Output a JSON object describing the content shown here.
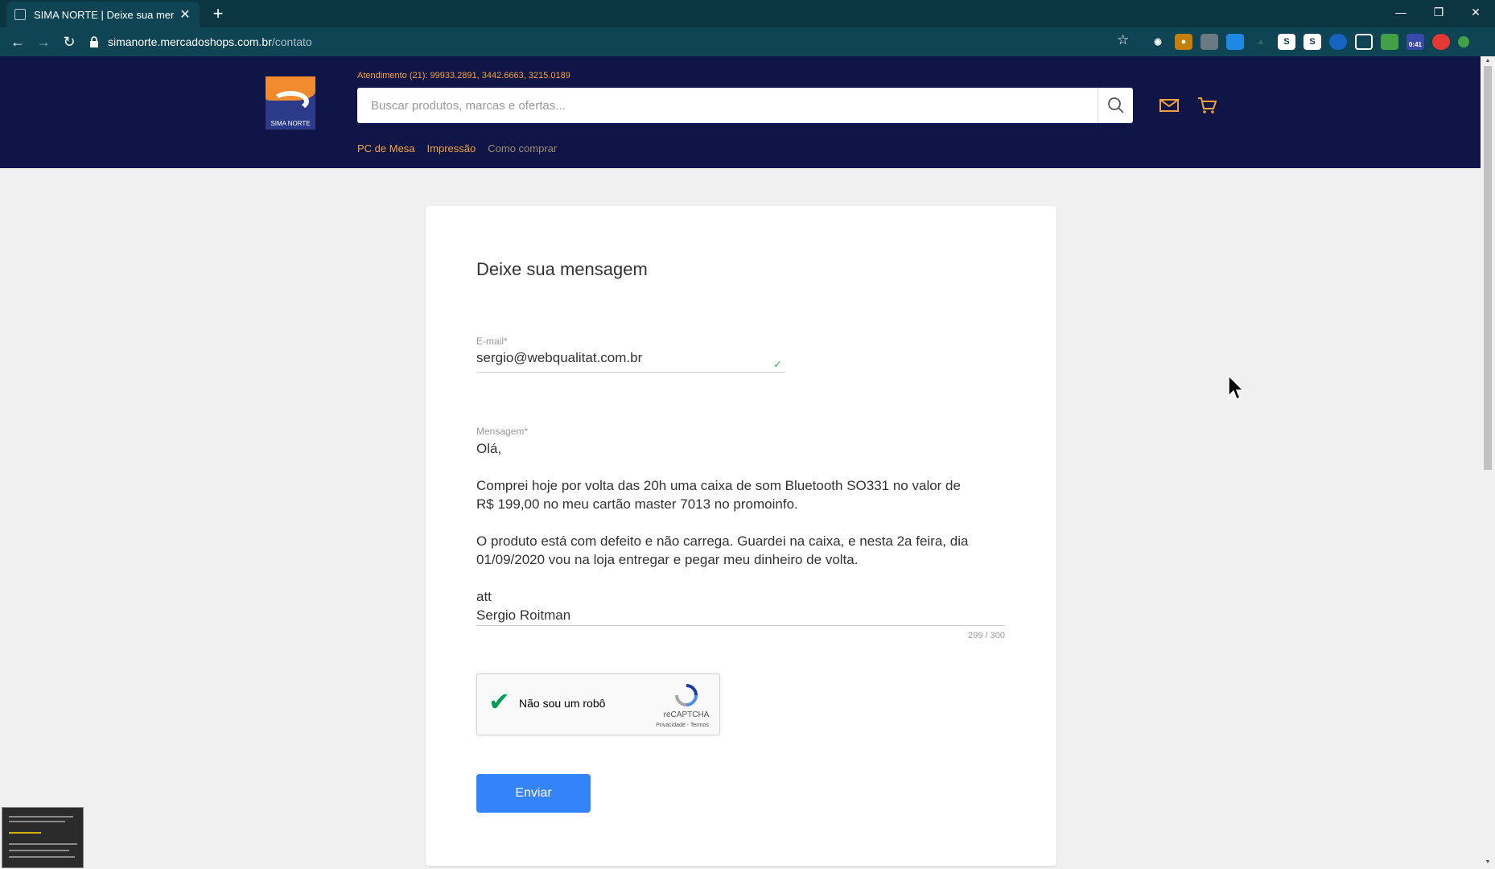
{
  "browser": {
    "tab_title": "SIMA NORTE | Deixe sua mensag",
    "tab_close": "✕",
    "new_tab": "+",
    "url_host": "simanorte.mercadoshops.com.br",
    "url_path": "/contato",
    "window_buttons": {
      "minimize": "—",
      "restore": "❐",
      "close": "✕"
    },
    "extension_badge": "0:41"
  },
  "header": {
    "logo_text": "SIMA NORTE",
    "phone": "Atendimento (21): 99933.2891, 3442.6663, 3215.0189",
    "search_placeholder": "Buscar produtos, marcas e ofertas...",
    "nav": [
      {
        "label": "PC de Mesa"
      },
      {
        "label": "Impressão"
      },
      {
        "label": "Como comprar"
      }
    ],
    "accent_color": "#f2a23c",
    "bg_color": "#101547"
  },
  "form": {
    "title": "Deixe sua mensagem",
    "email_label": "E-mail*",
    "email_value": "sergio@webqualitat.com.br",
    "message_label": "Mensagem*",
    "message_lines": {
      "l1": "Olá,",
      "l2": "Comprei hoje por volta das 20h uma caixa de som  Bluetooth SO331 no valor de",
      "l3": "R$ 199,00 no meu cartão master 7013 no promoinfo.",
      "l4": "O produto está com defeito e não carrega. Guardei na caixa, e nesta 2a feira, dia",
      "l5": "01/09/2020 vou na loja entregar e pegar meu dinheiro de volta.",
      "l6": "att",
      "l7": "Sergio Roitman"
    },
    "char_counter": "299 / 300",
    "recaptcha": {
      "label": "Não sou um robô",
      "brand": "reCAPTCHA",
      "links": "Privacidade - Termos"
    },
    "submit_label": "Enviar",
    "button_color": "#3483fa"
  }
}
